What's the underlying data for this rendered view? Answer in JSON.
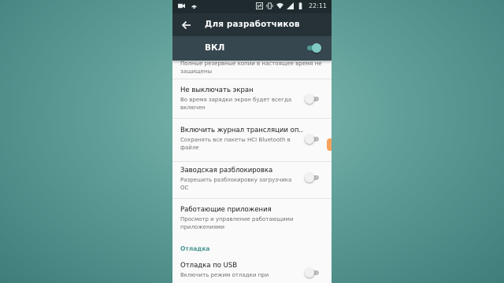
{
  "status_bar": {
    "time": "22:11",
    "icons": [
      "video-icon",
      "notification-icon",
      "nfc-icon",
      "vibrate-icon",
      "wifi-icon",
      "signal-icon",
      "battery-icon"
    ]
  },
  "toolbar": {
    "title": "Для разработчиков",
    "back_icon": "arrow-back-icon"
  },
  "master_switch": {
    "label": "ВКЛ",
    "state": true
  },
  "settings": {
    "partial": {
      "subtitle": "Полные резервные копии в настоящее время не защищены"
    },
    "items": [
      {
        "title": "Не выключать экран",
        "subtitle": "Во время зарядки экран будет всегда включен",
        "toggle": false
      },
      {
        "title": "Включить журнал трансляции оп..",
        "subtitle": "Сохранять все пакеты HCI Bluetooth в файле",
        "toggle": false
      },
      {
        "title": "Заводская разблокировка",
        "subtitle": "Разрешить разблокировку загрузчика ОС",
        "toggle": false
      },
      {
        "title": "Работающие приложения",
        "subtitle": "Просмотр и управление работающими приложениями"
      }
    ],
    "section_debug": "Отладка",
    "usb_debug": {
      "title": "Отладка по USB",
      "subtitle": "Включить режим отладки при",
      "toggle": false
    }
  },
  "colors": {
    "accent": "#4f9a94",
    "toolbar": "#263238",
    "masterbar": "#37474f",
    "scroll_indicator": "#f7a35c"
  }
}
